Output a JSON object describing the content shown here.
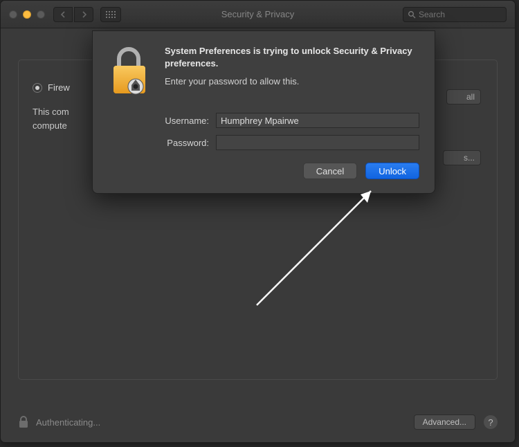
{
  "window": {
    "title": "Security & Privacy",
    "search_placeholder": "Search"
  },
  "background_panel": {
    "radio_label": "Firew",
    "desc_line1": "This com",
    "desc_line2": "compute",
    "firewall_btn": "all",
    "options_btn": "s..."
  },
  "footer": {
    "status": "Authenticating...",
    "advanced": "Advanced...",
    "help": "?"
  },
  "dialog": {
    "title": "System Preferences is trying to unlock Security & Privacy preferences.",
    "subtitle": "Enter your password to allow this.",
    "username_label": "Username:",
    "password_label": "Password:",
    "username_value": "Humphrey Mpairwe",
    "password_value": "",
    "cancel": "Cancel",
    "unlock": "Unlock"
  }
}
